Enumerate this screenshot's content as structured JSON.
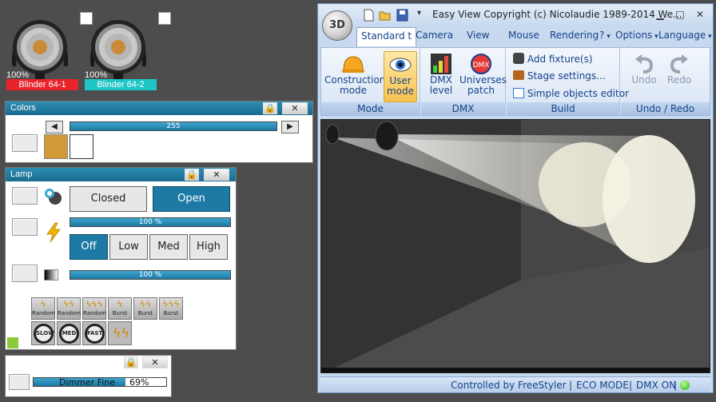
{
  "fixtures": [
    {
      "percent": "100%",
      "name": "Blinder 64-1",
      "color": "#e8232a"
    },
    {
      "percent": "100%",
      "name": "Blinder 64-2",
      "color": "#1fc6c6"
    }
  ],
  "colors_panel": {
    "title": "Colors",
    "lock_icon": "lock-icon",
    "close_label": "✕",
    "slider_value": "255",
    "swatch_color": "#d19a36",
    "swatch2_color": "#ffffff"
  },
  "lamp_panel": {
    "title": "Lamp",
    "close_label": "✕",
    "shutter_closed": "Closed",
    "shutter_open": "Open",
    "strobe_value": "100 %",
    "dimmer_value": "100 %",
    "strobe_buttons": [
      "Off",
      "Low",
      "Med",
      "High"
    ],
    "effect_labels": [
      "Random",
      "Random",
      "Random",
      "Burst",
      "Burst",
      "Burst"
    ],
    "round_labels": [
      "SLOW",
      "MED",
      "FAST"
    ]
  },
  "dimmer_panel": {
    "close_label": "✕",
    "label": "Dimmer Fine",
    "value": "69%"
  },
  "window": {
    "orb_label": "3D",
    "title": "Easy View   Copyright (c) Nicolaudie 1989-2014   We...",
    "tabs": [
      "Standard t",
      "Camera",
      "View",
      "Mouse",
      "Rendering"
    ],
    "help_label": "?",
    "options_label": "Options",
    "language_label": "Language",
    "groups": {
      "mode": {
        "label": "Mode",
        "construction": "Construction mode",
        "user": "User mode"
      },
      "dmx": {
        "label": "DMX",
        "level": "DMX level",
        "patch": "Universes patch"
      },
      "build": {
        "label": "Build",
        "add": "Add fixture(s)",
        "stage": "Stage settings...",
        "editor": "Simple objects editor"
      },
      "undo": {
        "label": "Undo / Redo",
        "undo": "Undo",
        "redo": "Redo"
      }
    },
    "status": {
      "controlled": "Controlled by FreeStyler",
      "eco": "ECO MODE",
      "dmx": "DMX ON"
    }
  }
}
